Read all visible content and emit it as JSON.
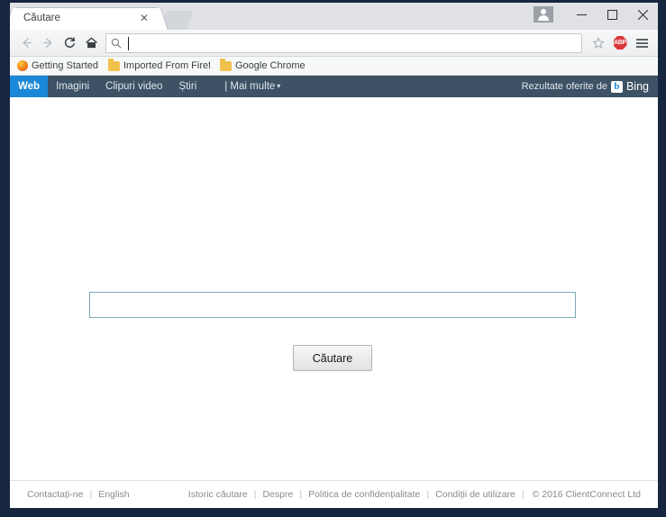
{
  "window": {
    "controls": {
      "avatar": "user-avatar",
      "minimize": "–",
      "maximize": "□",
      "close": "✕"
    }
  },
  "tabs": [
    {
      "title": "Căutare",
      "close_label": "✕",
      "active": true
    }
  ],
  "toolbar": {
    "back_label": "←",
    "forward_label": "→",
    "reload_label": "C",
    "home_label": "⌂",
    "omnibox_value": "",
    "omnibox_placeholder": "",
    "omnibox_icon": "search-icon",
    "bookmark_star": "☆",
    "adblock_label": "ABP",
    "menu_label": "menu"
  },
  "bookmarks": [
    {
      "label": "Getting Started",
      "icon": "firefox-icon"
    },
    {
      "label": "Imported From Firefo",
      "icon": "folder-icon"
    },
    {
      "label": "Google Chrome",
      "icon": "folder-icon"
    }
  ],
  "searchnav": {
    "items": [
      {
        "label": "Web",
        "active": true
      },
      {
        "label": "Imagini",
        "active": false
      },
      {
        "label": "Clipuri video",
        "active": false
      },
      {
        "label": "Știri",
        "active": false
      }
    ],
    "more_label": "| Mai multe",
    "more_caret": "▾",
    "powered_text": "Rezultate oferite de",
    "bing_mark": "b",
    "bing_word": "Bing"
  },
  "search": {
    "query_value": "",
    "query_placeholder": "",
    "button_label": "Căutare"
  },
  "footer": {
    "left": [
      {
        "label": "Contactați-ne"
      },
      {
        "label": "English"
      }
    ],
    "right": [
      {
        "label": "Istoric căutare"
      },
      {
        "label": "Despre"
      },
      {
        "label": "Politica de confidențialitate"
      },
      {
        "label": "Condiții de utilizare"
      }
    ],
    "separator": "|",
    "copyright": "© 2016 ClientConnect Ltd"
  },
  "colors": {
    "frame": "#16263f",
    "nav_bar": "#3d5265",
    "nav_active": "#1a87d8",
    "input_border": "#7fa8b8",
    "adblock_red": "#d9393c"
  }
}
